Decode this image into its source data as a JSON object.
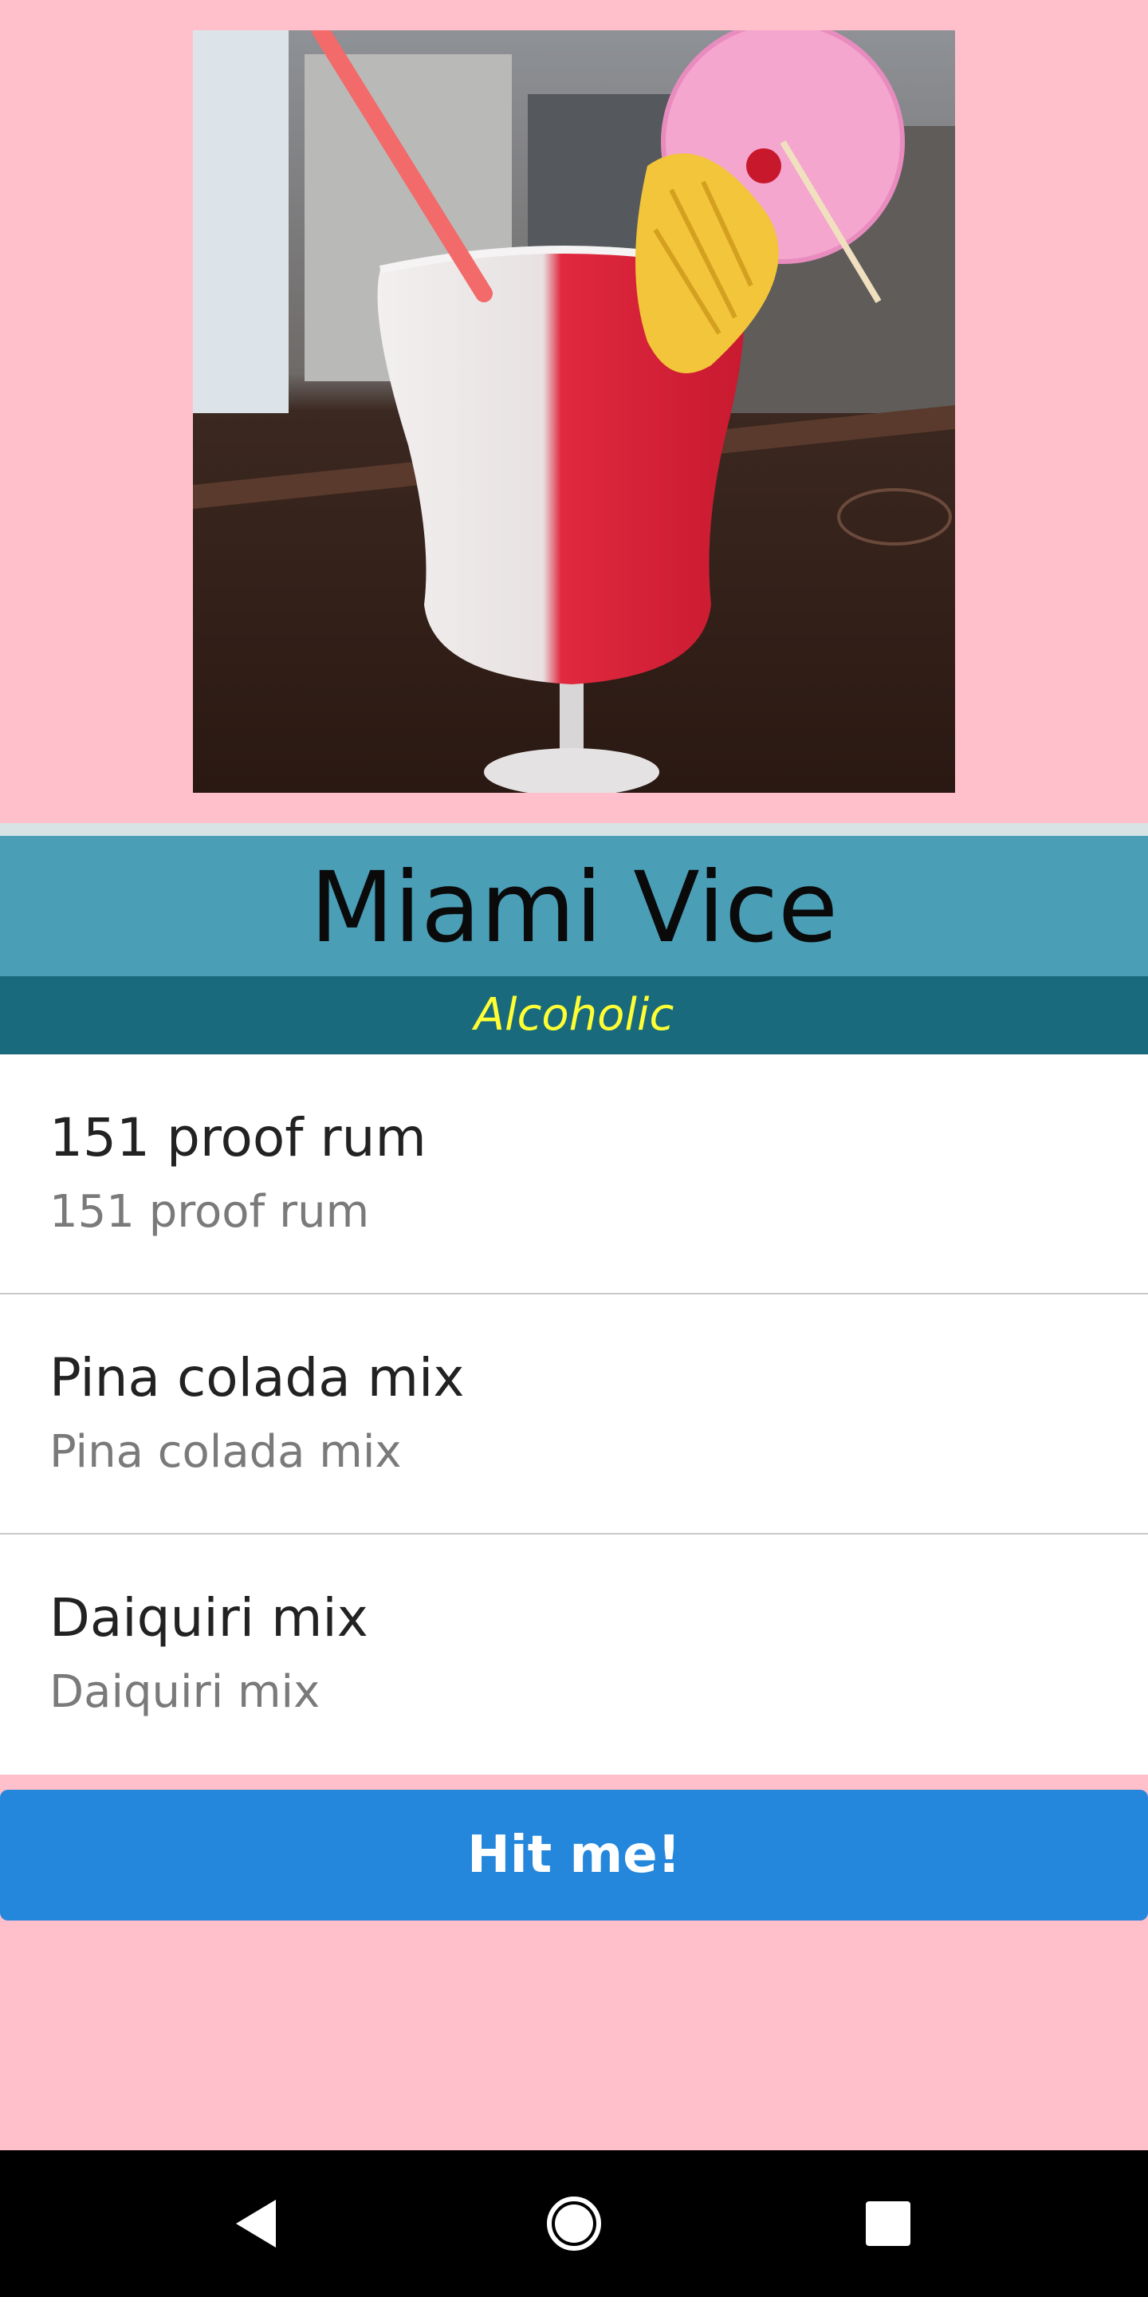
{
  "drink": {
    "name": "Miami Vice",
    "category": "Alcoholic",
    "image_alt": "Miami Vice cocktail"
  },
  "ingredients": [
    {
      "name": "151 proof rum",
      "measure": "151 proof rum"
    },
    {
      "name": "Pina colada mix",
      "measure": "Pina colada mix"
    },
    {
      "name": "Daiquiri mix",
      "measure": "Daiquiri mix"
    }
  ],
  "action_button": {
    "label": "Hit me!"
  },
  "colors": {
    "page_background": "#FFC0CB",
    "title_bar": "#4A9EB6",
    "subtitle_bar": "#196A7D",
    "subtitle_text": "#FFFF33",
    "button": "#2487DB",
    "navbar": "#000000"
  },
  "navbar": {
    "back": "back-icon",
    "home": "home-icon",
    "recents": "recents-icon"
  }
}
